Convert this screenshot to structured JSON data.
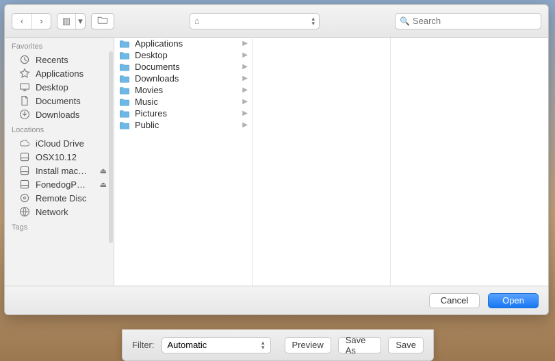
{
  "toolbar": {
    "search_placeholder": "Search"
  },
  "path": {
    "name": ""
  },
  "sidebar": {
    "sections": [
      {
        "title": "Favorites",
        "items": [
          {
            "icon": "recents",
            "label": "Recents"
          },
          {
            "icon": "apps",
            "label": "Applications"
          },
          {
            "icon": "desktop",
            "label": "Desktop"
          },
          {
            "icon": "documents",
            "label": "Documents"
          },
          {
            "icon": "downloads",
            "label": "Downloads"
          }
        ]
      },
      {
        "title": "Locations",
        "items": [
          {
            "icon": "cloud",
            "label": "iCloud Drive"
          },
          {
            "icon": "disk",
            "label": "OSX10.12"
          },
          {
            "icon": "disk",
            "label": "Install mac…",
            "eject": true
          },
          {
            "icon": "disk",
            "label": "FonedogP…",
            "eject": true
          },
          {
            "icon": "optical",
            "label": "Remote Disc"
          },
          {
            "icon": "network",
            "label": "Network"
          }
        ]
      },
      {
        "title": "Tags",
        "items": []
      }
    ]
  },
  "column0": [
    {
      "label": "Applications"
    },
    {
      "label": "Desktop"
    },
    {
      "label": "Documents"
    },
    {
      "label": "Downloads"
    },
    {
      "label": "Movies"
    },
    {
      "label": "Music"
    },
    {
      "label": "Pictures"
    },
    {
      "label": "Public"
    }
  ],
  "footer": {
    "cancel": "Cancel",
    "open": "Open"
  },
  "secondary": {
    "filter_label": "Filter:",
    "filter_value": "Automatic",
    "preview": "Preview",
    "save_as": "Save As",
    "save": "Save"
  },
  "icons": {
    "chevL": "‹",
    "chevR": "›",
    "columnsView": "▥",
    "chevDown": "▾",
    "newFolder": "▭",
    "home": "⌂",
    "up": "▴",
    "down": "▾",
    "eject": "⏏",
    "rowChev": "▶",
    "mag": "🔍"
  }
}
